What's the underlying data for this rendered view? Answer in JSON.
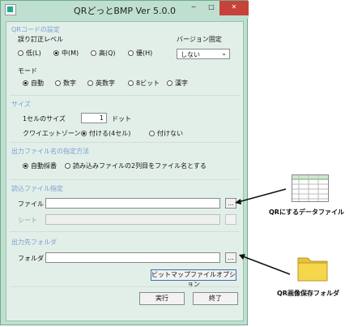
{
  "window": {
    "title": "QRどっとBMP Ver 5.0.0",
    "min_glyph": "─",
    "max_glyph": "□",
    "close_glyph": "✕"
  },
  "qr_settings": {
    "header": "QRコードの設定",
    "ecc": {
      "label": "誤り訂正レベル",
      "options": [
        "低(L)",
        "中(M)",
        "高(Q)",
        "優(H)"
      ],
      "selected": 1
    },
    "version": {
      "label": "バージョン固定",
      "value": "しない"
    },
    "mode": {
      "label": "モード",
      "options": [
        "自動",
        "数字",
        "英数字",
        "8ビット",
        "漢字"
      ],
      "selected": 0
    }
  },
  "size": {
    "header": "サイズ",
    "cell_label": "1セルのサイズ",
    "cell_value": "1",
    "cell_unit": "ドット",
    "quiet_label": "クワイエットゾーン",
    "quiet_options": [
      "付ける(4セル)",
      "付けない"
    ],
    "quiet_selected": 0
  },
  "naming": {
    "header": "出力ファイル名の指定方法",
    "options": [
      "自動採番",
      "読み込みファイルの2列目をファイル名とする"
    ],
    "selected": 0
  },
  "input_spec": {
    "header": "読込ファイル指定",
    "file_label": "ファイル",
    "file_value": "",
    "sheet_label": "シート",
    "sheet_value": "",
    "browse_label": "..."
  },
  "output": {
    "header": "出力先フォルダ",
    "folder_label": "フォルダ",
    "folder_value": "",
    "browse_label": "...",
    "bitmap_options_label": "ビットマップファイルオプション"
  },
  "actions": {
    "run_label": "実行",
    "exit_label": "終了"
  },
  "annotations": {
    "data_file": "QRにするデータファイル",
    "save_folder": "QR画像保存フォルダ"
  },
  "colors": {
    "frame": "#bfe0d0",
    "client": "#e2efe9",
    "section_header": "#7a9fd0",
    "close_button": "#c7423b",
    "folder_icon": "#f6d64a"
  }
}
